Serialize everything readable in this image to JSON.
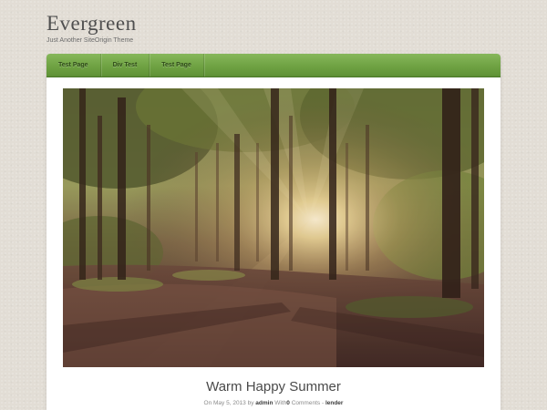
{
  "site": {
    "title": "Evergreen",
    "tagline": "Just Another SiteOrigin Theme"
  },
  "nav": {
    "items": [
      {
        "label": "Test Page"
      },
      {
        "label": "Div Test"
      },
      {
        "label": "Test Page"
      }
    ]
  },
  "post": {
    "title": "Warm Happy Summer",
    "meta": {
      "prefix": "On",
      "date": "May 5, 2013",
      "by": "by",
      "author": "admin",
      "with": "With",
      "comment_count": "0",
      "comments_word": "Comments",
      "separator": "-",
      "category": "lender"
    },
    "image_subject": "sunlit forest with path"
  },
  "colors": {
    "background": "#e2ddd5",
    "nav_green": "#6fa243",
    "content_bg": "#ffffff",
    "title_text": "#4f4f4f"
  }
}
